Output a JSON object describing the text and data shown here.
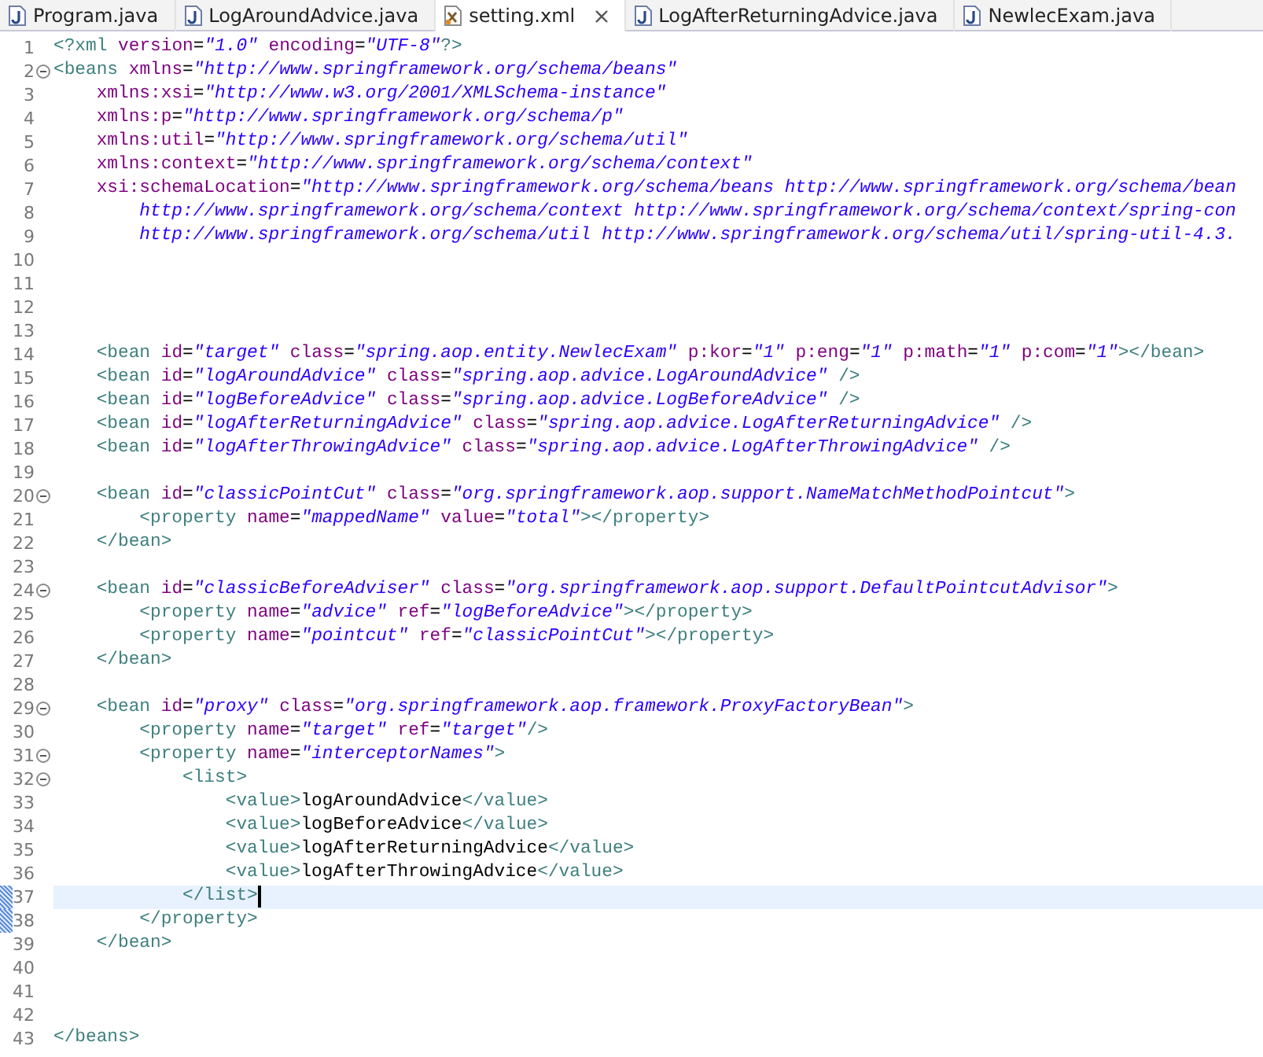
{
  "tabs": [
    {
      "label": "Program.java",
      "kind": "java",
      "selected": false
    },
    {
      "label": "LogAroundAdvice.java",
      "kind": "java",
      "selected": false
    },
    {
      "label": "setting.xml",
      "kind": "xml",
      "selected": true
    },
    {
      "label": "LogAfterReturningAdvice.java",
      "kind": "java",
      "selected": false
    },
    {
      "label": "NewlecExam.java",
      "kind": "java",
      "selected": false
    }
  ],
  "editor": {
    "lines": [
      {
        "number": "1",
        "text": "<?xml version=\"1.0\" encoding=\"UTF-8\"?>",
        "kind": "markup",
        "foldable": false,
        "current": false,
        "marked": false
      },
      {
        "number": "2",
        "text": "<beans xmlns=\"http://www.springframework.org/schema/beans\"",
        "kind": "markup",
        "foldable": true,
        "current": false,
        "marked": false
      },
      {
        "number": "3",
        "text": "    xmlns:xsi=\"http://www.w3.org/2001/XMLSchema-instance\"",
        "kind": "attributes",
        "foldable": false,
        "current": false,
        "marked": false
      },
      {
        "number": "4",
        "text": "    xmlns:p=\"http://www.springframework.org/schema/p\"",
        "kind": "attributes",
        "foldable": false,
        "current": false,
        "marked": false
      },
      {
        "number": "5",
        "text": "    xmlns:util=\"http://www.springframework.org/schema/util\"",
        "kind": "attributes",
        "foldable": false,
        "current": false,
        "marked": false
      },
      {
        "number": "6",
        "text": "    xmlns:context=\"http://www.springframework.org/schema/context\"",
        "kind": "attributes",
        "foldable": false,
        "current": false,
        "marked": false
      },
      {
        "number": "7",
        "text": "    xsi:schemaLocation=\"http://www.springframework.org/schema/beans http://www.springframework.org/schema/bean",
        "kind": "attributes",
        "foldable": false,
        "current": false,
        "marked": false
      },
      {
        "number": "8",
        "text": "        http://www.springframework.org/schema/context http://www.springframework.org/schema/context/spring-con",
        "kind": "value",
        "foldable": false,
        "current": false,
        "marked": false
      },
      {
        "number": "9",
        "text": "        http://www.springframework.org/schema/util http://www.springframework.org/schema/util/spring-util-4.3.",
        "kind": "value",
        "foldable": false,
        "current": false,
        "marked": false
      },
      {
        "number": "10",
        "foldable": false,
        "current": false,
        "marked": false
      },
      {
        "number": "11",
        "foldable": false,
        "current": false,
        "marked": false
      },
      {
        "number": "12",
        "foldable": false,
        "current": false,
        "marked": false
      },
      {
        "number": "13",
        "foldable": false,
        "current": false,
        "marked": false
      },
      {
        "number": "14",
        "text": "    <bean id=\"target\" class=\"spring.aop.entity.NewlecExam\" p:kor=\"1\" p:eng=\"1\" p:math=\"1\" p:com=\"1\"></bean>",
        "kind": "markup",
        "foldable": false,
        "current": false,
        "marked": false
      },
      {
        "number": "15",
        "text": "    <bean id=\"logAroundAdvice\" class=\"spring.aop.advice.LogAroundAdvice\" />",
        "kind": "markup",
        "foldable": false,
        "current": false,
        "marked": false
      },
      {
        "number": "16",
        "text": "    <bean id=\"logBeforeAdvice\" class=\"spring.aop.advice.LogBeforeAdvice\" />",
        "kind": "markup",
        "foldable": false,
        "current": false,
        "marked": false
      },
      {
        "number": "17",
        "text": "    <bean id=\"logAfterReturningAdvice\" class=\"spring.aop.advice.LogAfterReturningAdvice\" />",
        "kind": "markup",
        "foldable": false,
        "current": false,
        "marked": false
      },
      {
        "number": "18",
        "text": "    <bean id=\"logAfterThrowingAdvice\" class=\"spring.aop.advice.LogAfterThrowingAdvice\" />",
        "kind": "markup",
        "foldable": false,
        "current": false,
        "marked": false
      },
      {
        "number": "19",
        "foldable": false,
        "current": false,
        "marked": false
      },
      {
        "number": "20",
        "text": "    <bean id=\"classicPointCut\" class=\"org.springframework.aop.support.NameMatchMethodPointcut\">",
        "kind": "markup",
        "foldable": true,
        "current": false,
        "marked": false
      },
      {
        "number": "21",
        "text": "        <property name=\"mappedName\" value=\"total\"></property>",
        "kind": "markup",
        "foldable": false,
        "current": false,
        "marked": false
      },
      {
        "number": "22",
        "text": "    </bean>",
        "kind": "markup",
        "foldable": false,
        "current": false,
        "marked": false
      },
      {
        "number": "23",
        "foldable": false,
        "current": false,
        "marked": false
      },
      {
        "number": "24",
        "text": "    <bean id=\"classicBeforeAdviser\" class=\"org.springframework.aop.support.DefaultPointcutAdvisor\">",
        "kind": "markup",
        "foldable": true,
        "current": false,
        "marked": false
      },
      {
        "number": "25",
        "text": "        <property name=\"advice\" ref=\"logBeforeAdvice\"></property>",
        "kind": "markup",
        "foldable": false,
        "current": false,
        "marked": false
      },
      {
        "number": "26",
        "text": "        <property name=\"pointcut\" ref=\"classicPointCut\"></property>",
        "kind": "markup",
        "foldable": false,
        "current": false,
        "marked": false
      },
      {
        "number": "27",
        "text": "    </bean>",
        "kind": "markup",
        "foldable": false,
        "current": false,
        "marked": false
      },
      {
        "number": "28",
        "foldable": false,
        "current": false,
        "marked": false
      },
      {
        "number": "29",
        "text": "    <bean id=\"proxy\" class=\"org.springframework.aop.framework.ProxyFactoryBean\">",
        "kind": "markup",
        "foldable": true,
        "current": false,
        "marked": false
      },
      {
        "number": "30",
        "text": "        <property name=\"target\" ref=\"target\"/>",
        "kind": "markup",
        "foldable": false,
        "current": false,
        "marked": false
      },
      {
        "number": "31",
        "text": "        <property name=\"interceptorNames\">",
        "kind": "markup",
        "foldable": true,
        "current": false,
        "marked": false
      },
      {
        "number": "32",
        "text": "            <list>",
        "kind": "markup",
        "foldable": true,
        "current": false,
        "marked": false
      },
      {
        "number": "33",
        "text": "                <value>logAroundAdvice</value>",
        "kind": "markup",
        "foldable": false,
        "current": false,
        "marked": false
      },
      {
        "number": "34",
        "text": "                <value>logBeforeAdvice</value>",
        "kind": "markup",
        "foldable": false,
        "current": false,
        "marked": false
      },
      {
        "number": "35",
        "text": "                <value>logAfterReturningAdvice</value>",
        "kind": "markup",
        "foldable": false,
        "current": false,
        "marked": false
      },
      {
        "number": "36",
        "text": "                <value>logAfterThrowingAdvice</value>",
        "kind": "markup",
        "foldable": false,
        "current": false,
        "marked": false
      },
      {
        "number": "37",
        "text": "            </list>",
        "kind": "markup",
        "foldable": false,
        "current": true,
        "marked": true
      },
      {
        "number": "38",
        "text": "        </property>",
        "kind": "markup",
        "foldable": false,
        "current": false,
        "marked": true
      },
      {
        "number": "39",
        "text": "    </bean>",
        "kind": "markup",
        "foldable": false,
        "current": false,
        "marked": false
      },
      {
        "number": "40",
        "foldable": false,
        "current": false,
        "marked": false
      },
      {
        "number": "41",
        "foldable": false,
        "current": false,
        "marked": false
      },
      {
        "number": "42",
        "foldable": false,
        "current": false,
        "marked": false
      },
      {
        "number": "43",
        "text": "</beans>",
        "kind": "markup",
        "foldable": false,
        "current": false,
        "marked": false
      }
    ]
  }
}
